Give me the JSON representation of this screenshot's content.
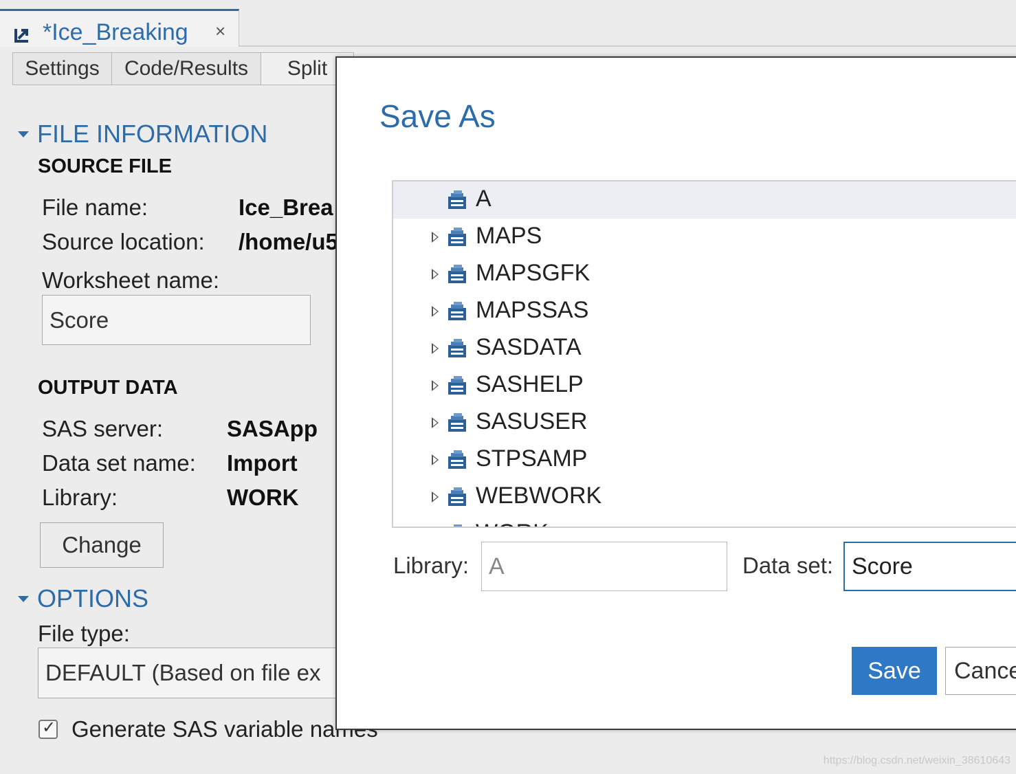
{
  "tab": {
    "title": "*Ice_Breaking",
    "close": "×"
  },
  "segments": [
    "Settings",
    "Code/Results",
    "Split"
  ],
  "file_information": {
    "heading": "FILE INFORMATION",
    "source_heading": "SOURCE FILE",
    "file_name_label": "File name:",
    "file_name_value": "Ice_Brea",
    "source_location_label": "Source location:",
    "source_location_value": "/home/u5",
    "worksheet_label": "Worksheet name:",
    "worksheet_value": "Score"
  },
  "output_data": {
    "heading": "OUTPUT DATA",
    "server_label": "SAS server:",
    "server_value": "SASApp",
    "dataset_label": "Data set name:",
    "dataset_value": "Import",
    "library_label": "Library:",
    "library_value": "WORK",
    "change_label": "Change"
  },
  "options": {
    "heading": "OPTIONS",
    "file_type_label": "File type:",
    "file_type_value": "DEFAULT (Based on file ex",
    "generate_names_label": "Generate SAS variable names",
    "generate_names_checked": true
  },
  "dialog": {
    "title": "Save As",
    "libraries": [
      {
        "name": "A",
        "selected": true,
        "expandable": false
      },
      {
        "name": "MAPS",
        "selected": false,
        "expandable": true
      },
      {
        "name": "MAPSGFK",
        "selected": false,
        "expandable": true
      },
      {
        "name": "MAPSSAS",
        "selected": false,
        "expandable": true
      },
      {
        "name": "SASDATA",
        "selected": false,
        "expandable": true
      },
      {
        "name": "SASHELP",
        "selected": false,
        "expandable": true
      },
      {
        "name": "SASUSER",
        "selected": false,
        "expandable": true
      },
      {
        "name": "STPSAMP",
        "selected": false,
        "expandable": true
      },
      {
        "name": "WEBWORK",
        "selected": false,
        "expandable": true
      },
      {
        "name": "WORK",
        "selected": false,
        "expandable": true
      }
    ],
    "library_label": "Library:",
    "library_value": "A",
    "dataset_label": "Data set:",
    "dataset_value": "Score",
    "save_label": "Save",
    "cancel_label": "Cance"
  },
  "watermark": "https://blog.csdn.net/weixin_38610643",
  "colors": {
    "accent": "#2d6ca8",
    "primary_button": "#2f78c6",
    "selected_row": "#eceef3"
  },
  "icons": {
    "tab": "import-arrow-icon",
    "library": "library-icon",
    "expander": "triangle-right-icon"
  }
}
